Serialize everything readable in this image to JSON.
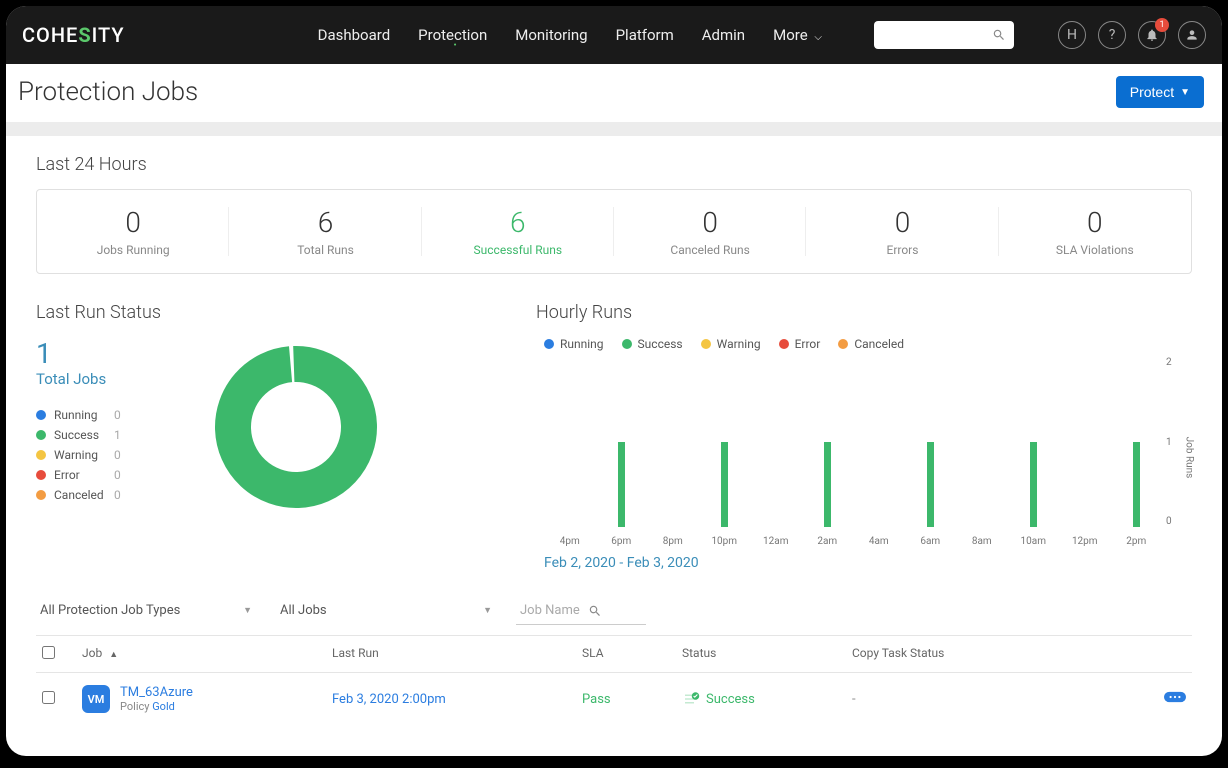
{
  "brand": {
    "pre": "COHE",
    "s": "S",
    "post": "ITY"
  },
  "nav": {
    "dashboard": "Dashboard",
    "protection": "Protection",
    "monitoring": "Monitoring",
    "platform": "Platform",
    "admin": "Admin",
    "more": "More"
  },
  "header_icons": {
    "cluster": "H",
    "help": "?",
    "bell_badge": "1"
  },
  "page": {
    "title": "Protection Jobs",
    "protect_button": "Protect"
  },
  "stats": {
    "title": "Last 24 Hours",
    "items": [
      {
        "value": "0",
        "label": "Jobs Running"
      },
      {
        "value": "6",
        "label": "Total Runs"
      },
      {
        "value": "6",
        "label": "Successful Runs",
        "accent": true
      },
      {
        "value": "0",
        "label": "Canceled Runs"
      },
      {
        "value": "0",
        "label": "Errors"
      },
      {
        "value": "0",
        "label": "SLA Violations"
      }
    ]
  },
  "last_run": {
    "title": "Last Run Status",
    "total_value": "1",
    "total_label": "Total Jobs",
    "legend": [
      {
        "label": "Running",
        "value": "0",
        "color": "#2b7de0"
      },
      {
        "label": "Success",
        "value": "1",
        "color": "#3cb86b"
      },
      {
        "label": "Warning",
        "value": "0",
        "color": "#f4c542"
      },
      {
        "label": "Error",
        "value": "0",
        "color": "#e74c3c"
      },
      {
        "label": "Canceled",
        "value": "0",
        "color": "#f39c42"
      }
    ]
  },
  "hourly": {
    "title": "Hourly Runs",
    "legend": [
      {
        "label": "Running",
        "color": "#2b7de0"
      },
      {
        "label": "Success",
        "color": "#3cb86b"
      },
      {
        "label": "Warning",
        "color": "#f4c542"
      },
      {
        "label": "Error",
        "color": "#e74c3c"
      },
      {
        "label": "Canceled",
        "color": "#f39c42"
      }
    ],
    "yaxis_label": "Job Runs",
    "date_range": "Feb 2, 2020 - Feb 3, 2020"
  },
  "filters": {
    "type": "All Protection Job Types",
    "scope": "All Jobs",
    "job_name_placeholder": "Job Name"
  },
  "table": {
    "headers": {
      "job": "Job",
      "last_run": "Last Run",
      "sla": "SLA",
      "status": "Status",
      "copy": "Copy Task Status"
    },
    "row": {
      "badge": "VM",
      "name": "TM_63Azure",
      "policy_prefix": "Policy ",
      "policy_name": "Gold",
      "last_run": "Feb 3, 2020 2:00pm",
      "sla": "Pass",
      "status": "Success",
      "copy": "-"
    }
  },
  "chart_data": {
    "type": "bar",
    "title": "Hourly Runs",
    "categories": [
      "4pm",
      "6pm",
      "8pm",
      "10pm",
      "12am",
      "2am",
      "4am",
      "6am",
      "8am",
      "10am",
      "12pm",
      "2pm"
    ],
    "values": [
      0,
      1,
      0,
      1,
      0,
      1,
      0,
      1,
      0,
      1,
      0,
      1
    ],
    "series_name": "Success",
    "ylabel": "Job Runs",
    "ylim": [
      0,
      2
    ],
    "yticks": [
      0,
      1,
      2
    ],
    "legend": [
      "Running",
      "Success",
      "Warning",
      "Error",
      "Canceled"
    ],
    "date_range": "Feb 2, 2020 - Feb 3, 2020",
    "donut": {
      "type": "pie",
      "title": "Last Run Status",
      "categories": [
        "Running",
        "Success",
        "Warning",
        "Error",
        "Canceled"
      ],
      "values": [
        0,
        1,
        0,
        0,
        0
      ],
      "total_label": "Total Jobs",
      "total": 1
    }
  }
}
